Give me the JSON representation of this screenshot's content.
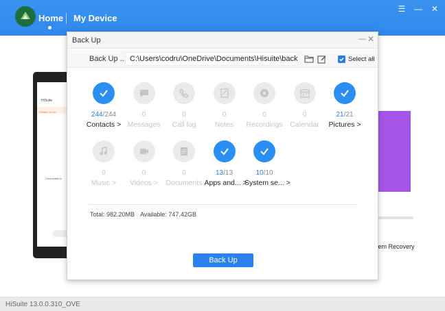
{
  "app": {
    "nav_home": "Home",
    "nav_device": "My Device",
    "status_bar": "HiSuite 13.0.0.310_OVE"
  },
  "background": {
    "phone_title": "HiSuite",
    "phone_warning": "Please do not",
    "phone_connected": "Connected to",
    "recovery_text": "tem Recovery"
  },
  "dialog": {
    "title": "Back Up",
    "path_label": "Back Up ...",
    "path_value": "C:\\Users\\codru\\OneDrive\\Documents\\Hisuite\\backup",
    "select_all_label": "Select all",
    "select_all_checked": true,
    "items": [
      {
        "name": "Contacts >",
        "num": "244",
        "den": "/244",
        "selected": true,
        "icon": "check-icon"
      },
      {
        "name": "Messages",
        "num": "0",
        "den": "",
        "selected": false,
        "icon": "message-icon"
      },
      {
        "name": "Call log",
        "num": "0",
        "den": "",
        "selected": false,
        "icon": "phone-icon"
      },
      {
        "name": "Notes",
        "num": "0",
        "den": "",
        "selected": false,
        "icon": "note-icon"
      },
      {
        "name": "Recordings",
        "num": "0",
        "den": "",
        "selected": false,
        "icon": "recording-icon"
      },
      {
        "name": "Calendar",
        "num": "0",
        "den": "",
        "selected": false,
        "icon": "calendar-icon"
      },
      {
        "name": "Pictures >",
        "num": "21",
        "den": "/21",
        "selected": true,
        "icon": "check-icon"
      },
      {
        "name": "Music >",
        "num": "0",
        "den": "",
        "selected": false,
        "icon": "music-icon"
      },
      {
        "name": "Videos >",
        "num": "0",
        "den": "",
        "selected": false,
        "icon": "video-icon"
      },
      {
        "name": "Documents",
        "num": "0",
        "den": "",
        "selected": false,
        "icon": "document-icon"
      },
      {
        "name": "Apps and... >",
        "num": "13",
        "den": "/13",
        "selected": true,
        "icon": "check-icon"
      },
      {
        "name": "System se... >",
        "num": "10",
        "den": "/10",
        "selected": true,
        "icon": "check-icon"
      }
    ],
    "total_label": "Total: 982.20MB",
    "available_label": "Available: 747.42GB",
    "backup_button": "Back Up"
  },
  "colors": {
    "accent": "#2a8ef2",
    "topbar": "#2f89ec",
    "purple_card": "#a457e6"
  }
}
